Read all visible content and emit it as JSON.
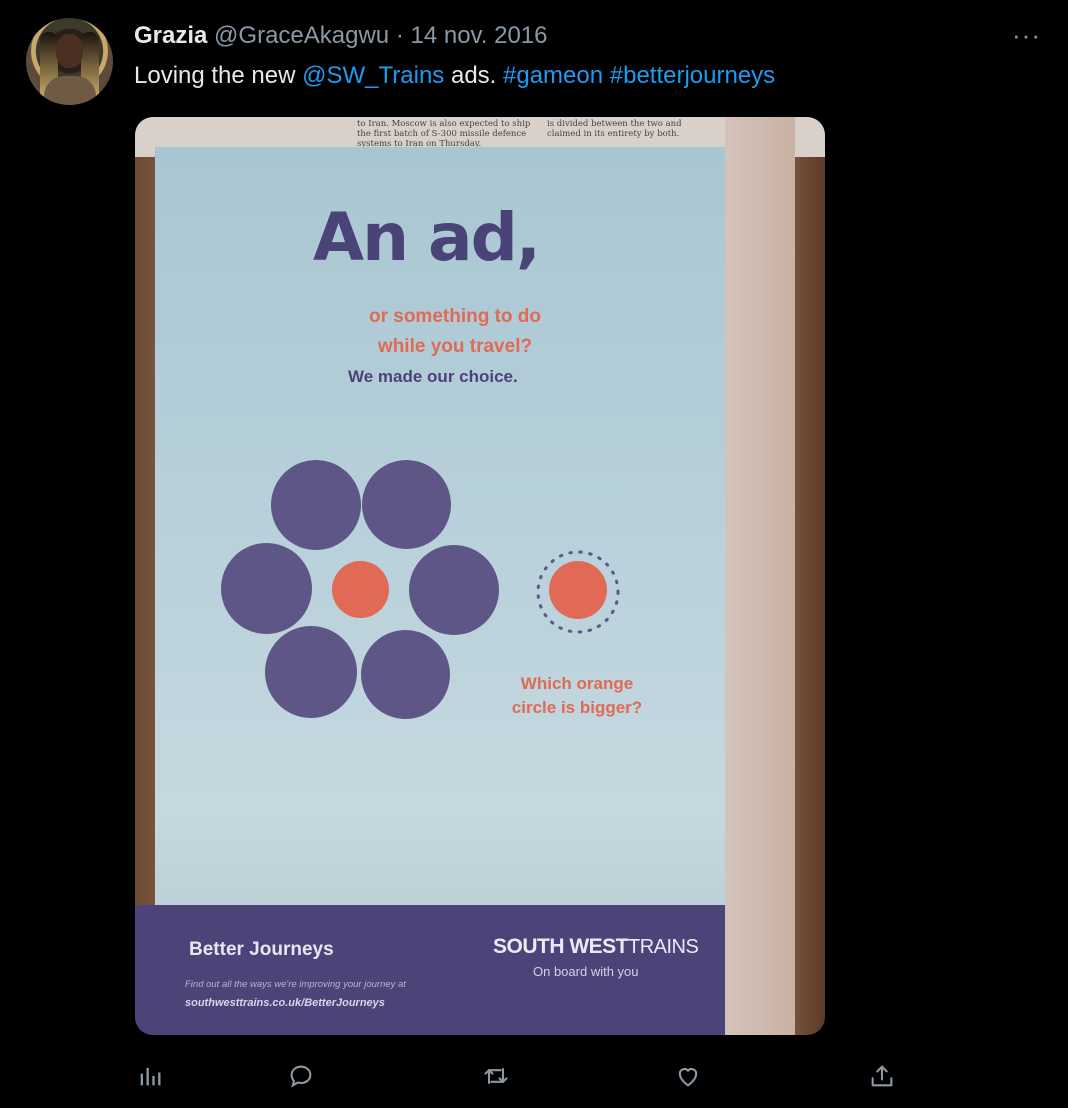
{
  "tweet": {
    "author_name": "Grazia",
    "handle": "@GraceAkagwu",
    "separator": "·",
    "date": "14 nov. 2016",
    "more": "···",
    "text_before": "Loving the new ",
    "mention": "@SW_Trains",
    "text_middle": " ads. ",
    "hashtag1": "#gameon",
    "hashtag_space": " ",
    "hashtag2": "#betterjourneys"
  },
  "photo": {
    "newspaper_left": "to Iran. Moscow is also expected to ship the first batch of S-300 missile defence systems to Iran on Thursday.",
    "newspaper_right": "is divided between the two and claimed in its entirety by both.",
    "ad": {
      "headline": "An ad,",
      "subline1": "or something to do",
      "subline2": "while you travel?",
      "choice": "We made our choice.",
      "question1": "Which orange",
      "question2": "circle is bigger?",
      "footer_title": "Better Journeys",
      "footer_text": "Find out all the ways we're improving your journey at",
      "footer_url": "southwesttrains.co.uk/BetterJourneys",
      "logo_bold": "SOUTH WEST",
      "logo_thin": "TRAINS",
      "logo_tagline": "On board with you"
    }
  },
  "actions": {
    "icons": [
      "analytics-icon",
      "reply-icon",
      "retweet-icon",
      "like-icon",
      "share-icon"
    ]
  },
  "colors": {
    "background": "#000000",
    "link": "#1d9bf0",
    "muted": "#8b98a5",
    "ad_purple": "#5e5687",
    "ad_orange": "#e06a55"
  }
}
